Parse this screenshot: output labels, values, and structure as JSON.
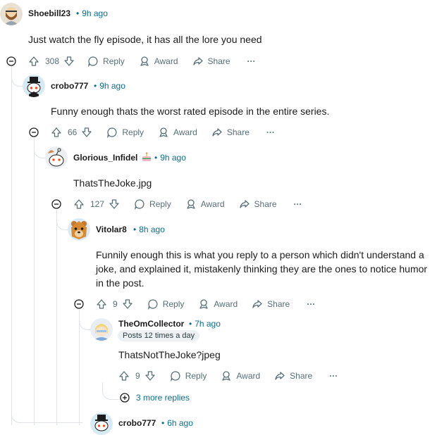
{
  "comments": [
    {
      "username": "Shoebill23",
      "time": "9h ago",
      "body": [
        "Just watch the fly episode, it has all the lore you need"
      ],
      "votes": "308"
    },
    {
      "username": "crobo777",
      "time": "9h ago",
      "body": [
        "Funny enough thats the worst rated episode in the entire series."
      ],
      "votes": "66"
    },
    {
      "username": "Glorious_Infidel",
      "time": "9h ago",
      "body": [
        "ThatsTheJoke.jpg"
      ],
      "votes": "127"
    },
    {
      "username": "Vitolar8",
      "time": "8h ago",
      "body": [
        "Funnily enough this is what you reply to a person which didn't understand a",
        "joke, and explained it, mistakenly thinking they are the ones to notice humor",
        "in the post."
      ],
      "votes": "9"
    },
    {
      "username": "TheOmCollector",
      "time": "7h ago",
      "flair": "Posts 12 times a day",
      "body": [
        "ThatsNotTheJoke?jpeg"
      ],
      "votes": "9"
    },
    {
      "username": "crobo777",
      "time": "6h ago"
    }
  ],
  "actions": {
    "reply": "Reply",
    "award": "Award",
    "share": "Share",
    "more": "···"
  },
  "more_replies": "3 more replies",
  "icons": {
    "upvote": "upvote-arrow-icon",
    "downvote": "downvote-arrow-icon",
    "reply": "speech-bubble-icon",
    "award": "award-medal-icon",
    "share": "share-arrow-icon",
    "collapse": "collapse-minus-icon",
    "expand": "expand-plus-icon",
    "flair_emoji": "cake-icon"
  },
  "colors": {
    "accent": "#0a6e8a",
    "meta": "#576f76",
    "thread": "#dfe3e6"
  }
}
